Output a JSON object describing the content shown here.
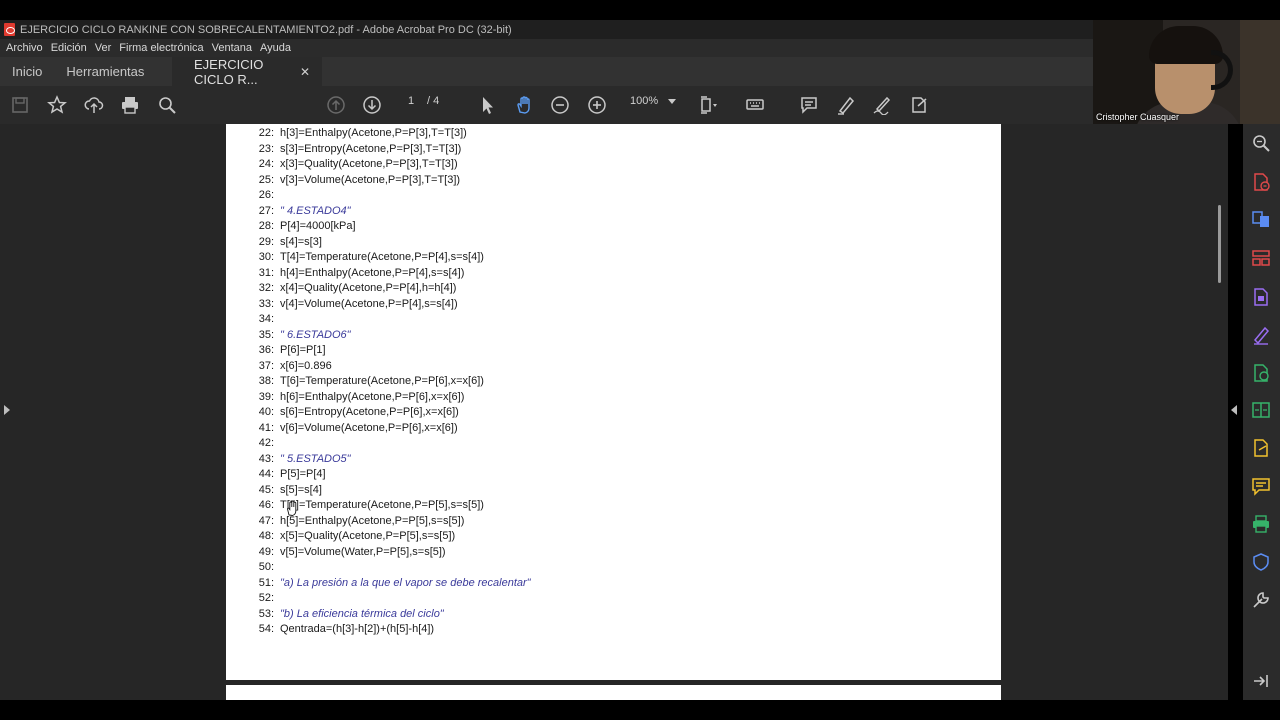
{
  "window": {
    "title": "EJERCICIO CICLO RANKINE CON SOBRECALENTAMIENTO2.pdf - Adobe Acrobat Pro DC (32-bit)"
  },
  "menu": [
    "Archivo",
    "Edición",
    "Ver",
    "Firma electrónica",
    "Ventana",
    "Ayuda"
  ],
  "tabs": {
    "home": "Inicio",
    "tools": "Herramientas",
    "document": "EJERCICIO CICLO R...",
    "close": "✕"
  },
  "toolbar": {
    "page_current": "1",
    "page_total": "/ 4",
    "zoom": "100%"
  },
  "document": {
    "lines": [
      {
        "n": "22:",
        "text": "h[3]=Enthalpy(Acetone,P=P[3],T=T[3])",
        "comment": false
      },
      {
        "n": "23:",
        "text": "s[3]=Entropy(Acetone,P=P[3],T=T[3])",
        "comment": false
      },
      {
        "n": "24:",
        "text": "x[3]=Quality(Acetone,P=P[3],T=T[3])",
        "comment": false
      },
      {
        "n": "25:",
        "text": "v[3]=Volume(Acetone,P=P[3],T=T[3])",
        "comment": false
      },
      {
        "n": "26:",
        "text": "",
        "comment": false
      },
      {
        "n": "27:",
        "text": "\" 4.ESTADO4\"",
        "comment": true
      },
      {
        "n": "28:",
        "text": "P[4]=4000[kPa]",
        "comment": false
      },
      {
        "n": "29:",
        "text": "s[4]=s[3]",
        "comment": false
      },
      {
        "n": "30:",
        "text": "T[4]=Temperature(Acetone,P=P[4],s=s[4])",
        "comment": false
      },
      {
        "n": "31:",
        "text": "h[4]=Enthalpy(Acetone,P=P[4],s=s[4])",
        "comment": false
      },
      {
        "n": "32:",
        "text": "x[4]=Quality(Acetone,P=P[4],h=h[4])",
        "comment": false
      },
      {
        "n": "33:",
        "text": "v[4]=Volume(Acetone,P=P[4],s=s[4])",
        "comment": false
      },
      {
        "n": "34:",
        "text": "",
        "comment": false
      },
      {
        "n": "35:",
        "text": "\" 6.ESTADO6\"",
        "comment": true
      },
      {
        "n": "36:",
        "text": "P[6]=P[1]",
        "comment": false
      },
      {
        "n": "37:",
        "text": "x[6]=0.896",
        "comment": false
      },
      {
        "n": "38:",
        "text": "T[6]=Temperature(Acetone,P=P[6],x=x[6])",
        "comment": false
      },
      {
        "n": "39:",
        "text": "h[6]=Enthalpy(Acetone,P=P[6],x=x[6])",
        "comment": false
      },
      {
        "n": "40:",
        "text": "s[6]=Entropy(Acetone,P=P[6],x=x[6])",
        "comment": false
      },
      {
        "n": "41:",
        "text": "v[6]=Volume(Acetone,P=P[6],x=x[6])",
        "comment": false
      },
      {
        "n": "42:",
        "text": "",
        "comment": false
      },
      {
        "n": "43:",
        "text": "\" 5.ESTADO5\"",
        "comment": true
      },
      {
        "n": "44:",
        "text": "P[5]=P[4]",
        "comment": false
      },
      {
        "n": "45:",
        "text": "s[5]=s[4]",
        "comment": false
      },
      {
        "n": "46:",
        "text": "T[5]=Temperature(Acetone,P=P[5],s=s[5])",
        "comment": false
      },
      {
        "n": "47:",
        "text": "h[5]=Enthalpy(Acetone,P=P[5],s=s[5])",
        "comment": false
      },
      {
        "n": "48:",
        "text": "x[5]=Quality(Acetone,P=P[5],s=s[5])",
        "comment": false
      },
      {
        "n": "49:",
        "text": "v[5]=Volume(Water,P=P[5],s=s[5])",
        "comment": false
      },
      {
        "n": "50:",
        "text": "",
        "comment": false
      },
      {
        "n": "51:",
        "text": "\"a) La presión a la que el vapor se debe recalentar\"",
        "comment": true
      },
      {
        "n": "52:",
        "text": "",
        "comment": false
      },
      {
        "n": "53:",
        "text": "\"b) La eficiencia térmica del ciclo\"",
        "comment": true
      },
      {
        "n": "54:",
        "text": "Qentrada=(h[3]-h[2])+(h[5]-h[4])",
        "comment": false
      }
    ]
  },
  "webcam": {
    "participant_name": "Cristopher Cuasquer"
  },
  "colors": {
    "comment_text": "#3a3a9a",
    "toolbar_bg": "#2a2a2a",
    "pdf_red": "#e03a2f",
    "tool_red": "#e0494a",
    "tool_blue": "#5b8cf2",
    "tool_purple": "#9a6df2",
    "tool_green": "#36b36a",
    "tool_yellow": "#f2c12e"
  }
}
